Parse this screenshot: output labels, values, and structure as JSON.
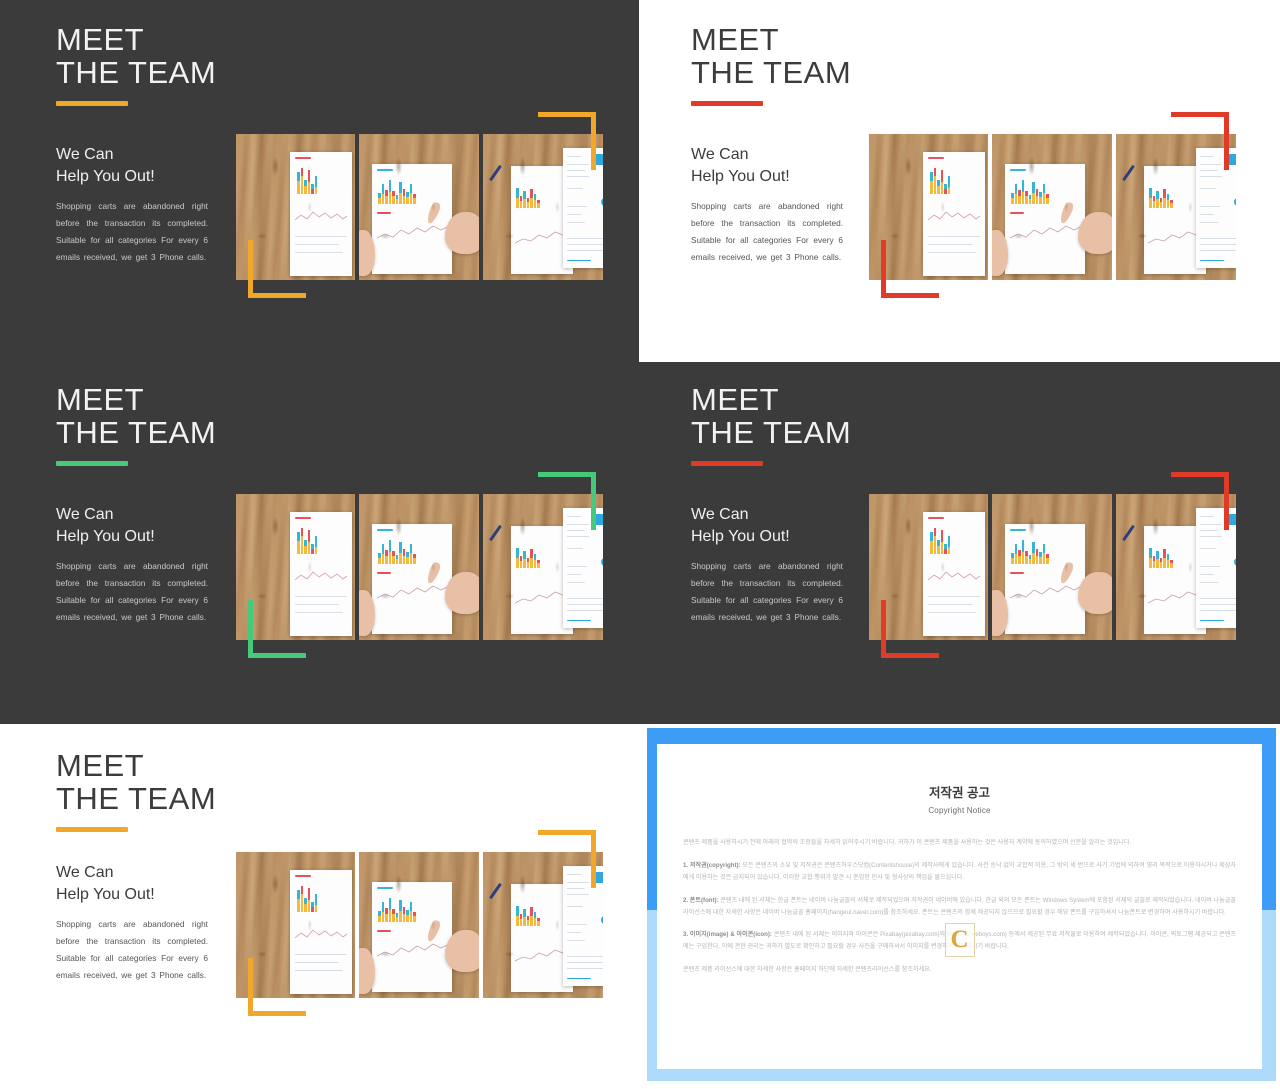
{
  "meta": {
    "accent_amber": "#f0a72a",
    "accent_red": "#e03a29",
    "accent_green": "#45c97a",
    "dark_bg": "#3b3b3b",
    "light_bg": "#ffffff",
    "blue_strong": "#3d9cf5",
    "blue_soft": "#aedbfb"
  },
  "slides": [
    {
      "id": "slide-1",
      "theme": "dark",
      "accent": "#f0a72a",
      "title_line1": "MEET",
      "title_line2": "THE TEAM",
      "subhead_line1": "We Can",
      "subhead_line2": "Help You Out!",
      "body": "Shopping carts are abandoned right before the transaction its completed. Suitable for all categories For every 6 emails received, we get 3 Phone calls."
    },
    {
      "id": "slide-2",
      "theme": "light",
      "accent": "#e03a29",
      "title_line1": "MEET",
      "title_line2": "THE TEAM",
      "subhead_line1": "We Can",
      "subhead_line2": "Help You Out!",
      "body": "Shopping carts are abandoned right before the transaction its completed. Suitable for all categories For every 6 emails received, we get 3 Phone calls."
    },
    {
      "id": "slide-3",
      "theme": "dark",
      "accent": "#45c97a",
      "title_line1": "MEET",
      "title_line2": "THE TEAM",
      "subhead_line1": "We Can",
      "subhead_line2": "Help You Out!",
      "body": "Shopping carts are abandoned right before the transaction its completed. Suitable for all categories For every 6 emails received, we get 3 Phone calls."
    },
    {
      "id": "slide-4",
      "theme": "dark",
      "accent": "#e03a29",
      "title_line1": "MEET",
      "title_line2": "THE TEAM",
      "subhead_line1": "We Can",
      "subhead_line2": "Help You Out!",
      "body": "Shopping carts are abandoned right before the transaction its completed. Suitable for all categories For every 6 emails received, we get 3 Phone calls."
    },
    {
      "id": "slide-5",
      "theme": "light",
      "accent": "#f0a72a",
      "title_line1": "MEET",
      "title_line2": "THE TEAM",
      "subhead_line1": "We Can",
      "subhead_line2": "Help You Out!",
      "body": "Shopping carts are abandoned right before the transaction its completed. Suitable for all categories For every 6 emails received, we get 3 Phone calls."
    }
  ],
  "copyright": {
    "title": "저작권 공고",
    "subtitle": "Copyright Notice",
    "intro": "콘텐츠 제품을 사용하시기 전에 아래의 협약의 조항들을 자세히 읽어주시기 바랍니다. 귀하가 이 콘텐츠 제품을 사용하는 것은 사용자 계약에 동의하였으며 신분을 알리는 것입니다.",
    "sections": [
      {
        "label": "1. 저작권(copyright):",
        "text": "모든 콘텐츠의 소유 및 저작권은 콘텐츠하우스닷컴(Contentshouse)의 제작사에게 있습니다. 사전 승낙 없이 교합적 이용, 그 밖의 세 번으로 사기 기법에 의하여 영리 목적으로 이용하시거나 제삼자에게 이용하는 것은 금지되어 있습니다. 이러한 교합 행위가 발견 시 준엄한 민사 및 형사상의 책임을 물으십니다."
      },
      {
        "label": "2. 폰트(font):",
        "text": "콘텐츠 내에 된 서체는 한글 폰트는 네이버 나눔글꼴의 서체로 제작되었으며 저작권이 네이버에 있습니다. 한글 외의 모든 폰트는 Windows System에 포함된 서체의 글꼴로 제작되었습니다. 네이버 나눔글꼴 라이선스에 대한 자세한 사항은 네이버 나눔글꼴 홈페이지(hangeul.naver.com)를 참조하세요. 폰트는 콘텐츠의 함께 제공되지 않으므로 필요할 경우 해당 폰트를 구입하셔서 나눔폰트로 변경하여 사용하시기 바랍니다."
      },
      {
        "label": "3. 이미지(image) & 아이콘(icon):",
        "text": "콘텐츠 내에 된 서체는 이미지와 아이콘은 Pixabay(pixabay.com)와 Weboys(weboys.com) 등에서 제공된 무료 저작물로 이용하여 제작되었습니다. 아이콘, 픽토그램 제공되고 콘텐츠에는 구입한다. 이에 관한 권리는 귀하가 별도로 확인하고 필요할 경우 사진을 구매하셔서 이미지를 변경하여 사용하시기 바랍니다."
      }
    ],
    "outro": "콘텐츠 제품 라이선스에 대한 자세한 사항은 홈페이지 하단에 자세한 콘텐츠라이선스를 참조하세요.",
    "watermark": "C"
  }
}
